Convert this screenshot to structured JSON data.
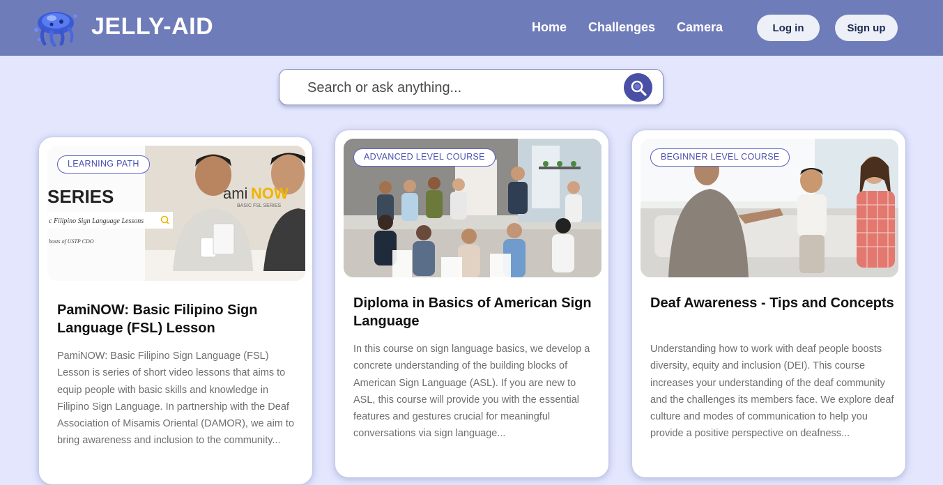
{
  "header": {
    "brand": "JELLY-AID",
    "logo_icon": "jellyfish-logo-icon",
    "nav": [
      "Home",
      "Challenges",
      "Camera"
    ],
    "login_label": "Log in",
    "signup_label": "Sign up"
  },
  "search": {
    "placeholder": "Search or ask anything...",
    "icon": "search-icon"
  },
  "cards": [
    {
      "badge": "LEARNING PATH",
      "title": "PamiNOW: Basic Filipino Sign Language (FSL) Lesson",
      "description": "PamiNOW: Basic Filipino Sign Language (FSL) Lesson is series of short video lessons that aims to equip people with basic skills and knowledge in Filipino Sign Language. In partnership with the Deaf Association of Misamis Oriental (DAMOR), we aim to bring awareness and inclusion to the community...",
      "image_text": {
        "series": "SERIES",
        "logo_pami": "ami",
        "logo_now": "NOW",
        "logo_sub": "BASIC FSL SERIES",
        "search_text": "c Filipino Sign Language Lessons",
        "hosts": "hosts of USTP CDO"
      }
    },
    {
      "badge": "ADVANCED LEVEL COURSE",
      "title": "Diploma in Basics of American Sign Language",
      "description": "In this course on sign language basics, we develop a concrete understanding of the building blocks of American Sign Language (ASL). If you are new to ASL, this course will provide you with the essential features and gestures crucial for meaningful conversations via sign language..."
    },
    {
      "badge": "BEGINNER LEVEL COURSE",
      "title": "Deaf Awareness - Tips and Concepts",
      "description": "Understanding how to work with deaf people boosts diversity, equity and inclusion (DEI). This course increases your understanding of the deaf community and the challenges its members face. We explore deaf culture and modes of communication to help you provide a positive perspective on deafness..."
    }
  ],
  "colors": {
    "navbar": "#6f7cba",
    "page_bg": "#e3e6fd",
    "accent": "#4a4fa6"
  }
}
